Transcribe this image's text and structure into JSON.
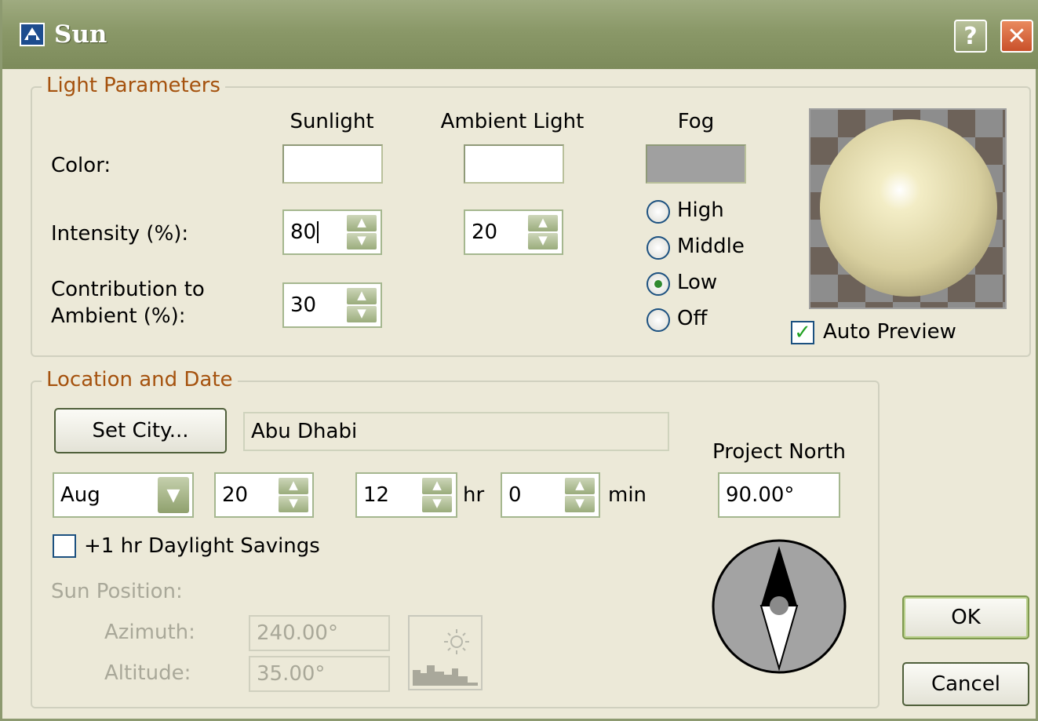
{
  "title": "Sun",
  "titlebar": {
    "help": "?",
    "close": "✕"
  },
  "light": {
    "legend": "Light Parameters",
    "col_sunlight": "Sunlight",
    "col_ambient": "Ambient Light",
    "col_fog": "Fog",
    "color_label": "Color:",
    "intensity_label": "Intensity (%):",
    "contribution_label_1": "Contribution to",
    "contribution_label_2": "Ambient (%):",
    "sun_intensity": "80",
    "ambient_intensity": "20",
    "contribution": "30",
    "sunlight_color": "#ffffff",
    "ambient_color": "#ffffff",
    "fog_color": "#a0a0a0",
    "fog_options": [
      "High",
      "Middle",
      "Low",
      "Off"
    ],
    "fog_selected": "Low",
    "auto_preview_label": "Auto Preview",
    "auto_preview_checked": true
  },
  "location": {
    "legend": "Location and Date",
    "set_city_button": "Set City...",
    "city": "Abu Dhabi",
    "month": "Aug",
    "day": "20",
    "hour": "12",
    "hr_label": "hr",
    "minute": "0",
    "min_label": "min",
    "project_north_label": "Project North",
    "project_north": "90.00°",
    "daylight_savings_label": "+1 hr Daylight Savings",
    "daylight_savings_checked": false,
    "sun_position_label": "Sun Position:",
    "azimuth_label": "Azimuth:",
    "azimuth": "240.00°",
    "altitude_label": "Altitude:",
    "altitude": "35.00°"
  },
  "buttons": {
    "ok": "OK",
    "cancel": "Cancel"
  }
}
